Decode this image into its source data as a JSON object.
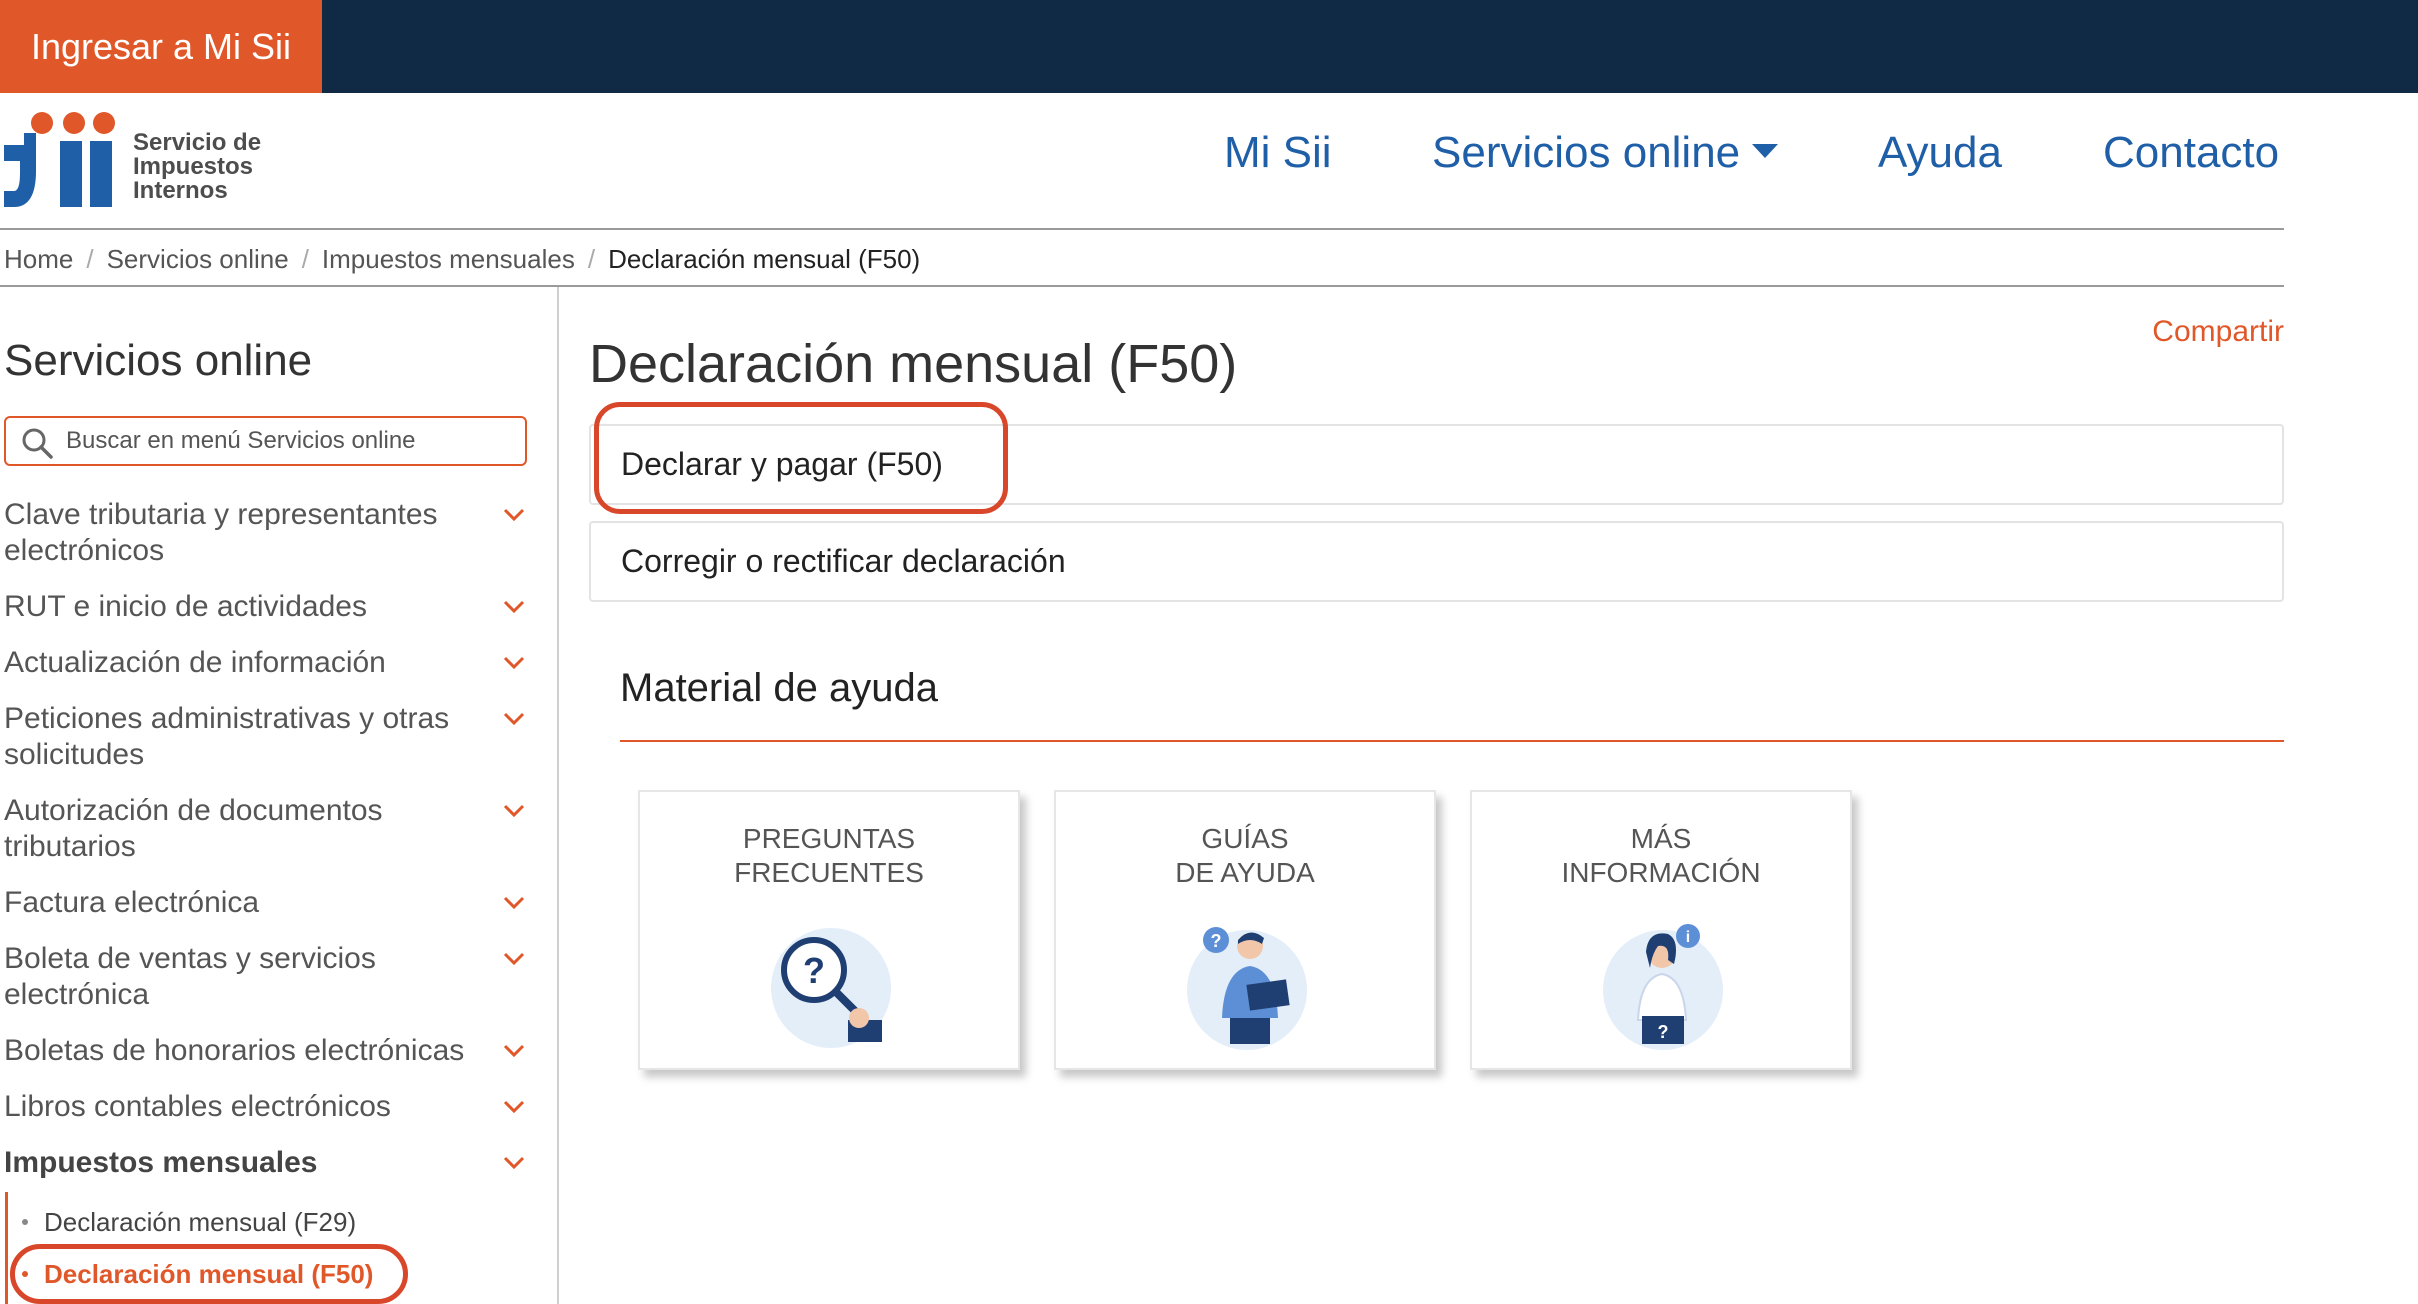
{
  "topbar": {
    "login_label": "Ingresar a Mi Sii"
  },
  "logo": {
    "brand": "Sii",
    "line1": "Servicio de",
    "line2": "Impuestos",
    "line3": "Internos"
  },
  "nav": {
    "items": [
      {
        "label": "Mi Sii"
      },
      {
        "label": "Servicios online",
        "has_dropdown": true
      },
      {
        "label": "Ayuda"
      },
      {
        "label": "Contacto"
      }
    ]
  },
  "breadcrumb": {
    "items": [
      "Home",
      "Servicios online",
      "Impuestos mensuales"
    ],
    "current": "Declaración mensual (F50)",
    "separator": "/"
  },
  "sidebar": {
    "title": "Servicios online",
    "search_placeholder": "Buscar en menú Servicios online",
    "items": [
      {
        "label": "Clave tributaria y representantes electrónicos"
      },
      {
        "label": "RUT e inicio de actividades"
      },
      {
        "label": "Actualización de información"
      },
      {
        "label": "Peticiones administrativas y otras solicitudes"
      },
      {
        "label": "Autorización de documentos tributarios"
      },
      {
        "label": "Factura electrónica"
      },
      {
        "label": "Boleta de ventas y servicios electrónica"
      },
      {
        "label": "Boletas de honorarios electrónicas"
      },
      {
        "label": "Libros contables electrónicos"
      },
      {
        "label": "Impuestos mensuales",
        "expanded": true
      }
    ],
    "subitems": [
      {
        "label": "Declaración mensual (F29)"
      },
      {
        "label": "Declaración mensual (F50)",
        "active": true
      }
    ]
  },
  "main": {
    "share_label": "Compartir",
    "title": "Declaración mensual (F50)",
    "options": [
      {
        "label": "Declarar y pagar (F50)"
      },
      {
        "label": "Corregir o rectificar declaración"
      }
    ],
    "help": {
      "title": "Material de ayuda",
      "cards": [
        {
          "line1": "PREGUNTAS",
          "line2": "FRECUENTES",
          "icon": "question-magnifier-icon"
        },
        {
          "line1": "GUÍAS",
          "line2": "DE AYUDA",
          "icon": "person-reading-guide-icon"
        },
        {
          "line1": "MÁS",
          "line2": "INFORMACIÓN",
          "icon": "person-info-icon"
        }
      ]
    }
  },
  "colors": {
    "topbar": "#102a45",
    "accent_orange": "#e0582a",
    "nav_blue": "#1f5fa8",
    "annotation_red": "#d9472b"
  }
}
